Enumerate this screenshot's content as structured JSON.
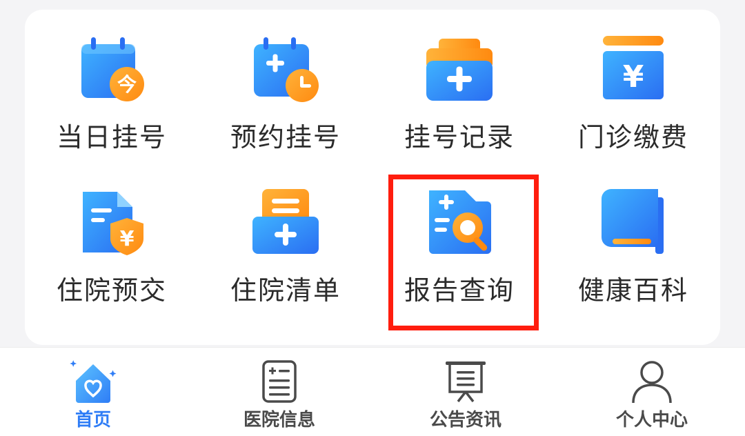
{
  "grid": {
    "items": [
      {
        "label": "当日挂号",
        "icon": "calendar-today-icon"
      },
      {
        "label": "预约挂号",
        "icon": "calendar-clock-icon"
      },
      {
        "label": "挂号记录",
        "icon": "medical-kit-icon"
      },
      {
        "label": "门诊缴费",
        "icon": "yen-payment-icon"
      },
      {
        "label": "住院预交",
        "icon": "document-yen-icon"
      },
      {
        "label": "住院清单",
        "icon": "list-box-icon"
      },
      {
        "label": "报告查询",
        "icon": "report-search-icon"
      },
      {
        "label": "健康百科",
        "icon": "book-icon"
      }
    ]
  },
  "tabbar": {
    "items": [
      {
        "label": "首页",
        "icon": "home-heart-icon",
        "active": true
      },
      {
        "label": "医院信息",
        "icon": "hospital-info-icon",
        "active": false
      },
      {
        "label": "公告资讯",
        "icon": "notice-board-icon",
        "active": false
      },
      {
        "label": "个人中心",
        "icon": "user-icon",
        "active": false
      }
    ]
  },
  "icon_glyphs": {
    "today": "今",
    "yen": "¥"
  },
  "colors": {
    "primary_blue": "#2f7df6",
    "orange": "#ff9a1f",
    "highlight_red": "#ff1d0e",
    "text": "#2b2b2b"
  }
}
